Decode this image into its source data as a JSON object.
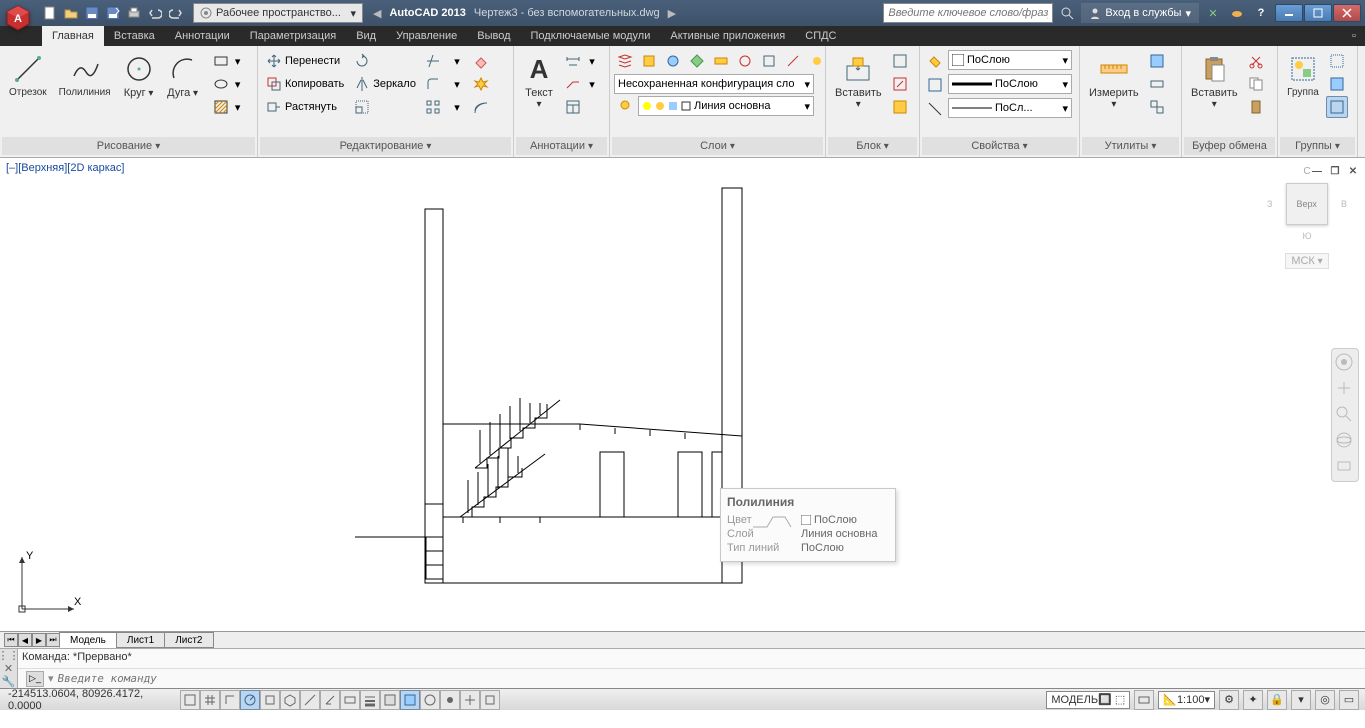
{
  "title": {
    "app": "AutoCAD 2013",
    "doc": "Чертеж3 - без вспомогательных.dwg"
  },
  "workspace": "Рабочее пространство...",
  "search_placeholder": "Введите ключевое слово/фразу",
  "signin": "Вход в службы",
  "tabs": [
    "Главная",
    "Вставка",
    "Аннотации",
    "Параметризация",
    "Вид",
    "Управление",
    "Вывод",
    "Подключаемые модули",
    "Активные приложения",
    "СПДС"
  ],
  "panels": {
    "draw": {
      "title": "Рисование",
      "items": [
        "Отрезок",
        "Полилиния",
        "Круг",
        "Дуга"
      ]
    },
    "modify": {
      "title": "Редактирование",
      "move": "Перенести",
      "copy": "Копировать",
      "stretch": "Растянуть",
      "mirror": "Зеркало"
    },
    "annot": {
      "title": "Аннотации",
      "text": "Текст"
    },
    "layers": {
      "title": "Слои",
      "combo": "Несохраненная конфигурация сло",
      "layer": "Линия основна"
    },
    "block": {
      "title": "Блок",
      "insert": "Вставить"
    },
    "props": {
      "title": "Свойства",
      "color": "ПоСлою",
      "ltype": "ПоСлою",
      "lweight": "ПоСл..."
    },
    "utils": {
      "title": "Утилиты",
      "measure": "Измерить"
    },
    "clip": {
      "title": "Буфер обмена",
      "paste": "Вставить"
    },
    "groups": {
      "title": "Группы",
      "group": "Группа"
    }
  },
  "viewport_label": "[–][Верхняя][2D каркас]",
  "viewcube": {
    "n": "С",
    "s": "Ю",
    "e": "В",
    "w": "З",
    "face": "Верх",
    "wcs": "МСК"
  },
  "tooltip": {
    "title": "Полилиния",
    "rows": [
      [
        "Цвет",
        "ПоСлою"
      ],
      [
        "Слой",
        "Линия основна"
      ],
      [
        "Тип линий",
        "ПоСлою"
      ]
    ]
  },
  "sheet_tabs": [
    "Модель",
    "Лист1",
    "Лист2"
  ],
  "cmd_history": "Команда: *Прервано*",
  "cmd_placeholder": "Введите команду",
  "status": {
    "coords": "-214513.0604, 80926.4172, 0.0000",
    "model": "МОДЕЛЬ",
    "scale": "1:100"
  }
}
